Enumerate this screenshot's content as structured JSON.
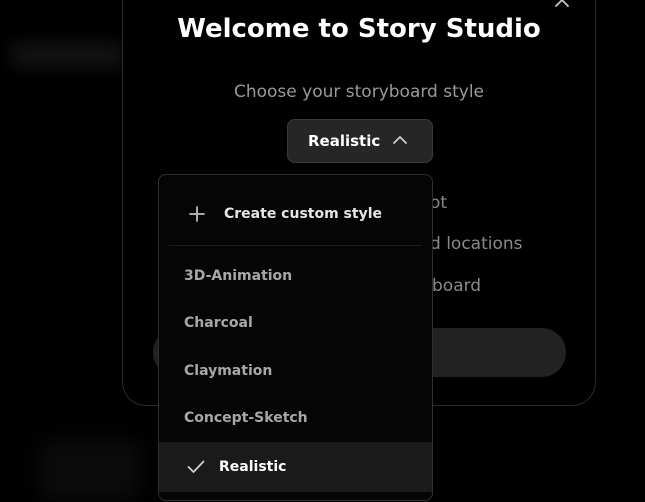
{
  "modal": {
    "title": "Welcome to Story Studio",
    "subtitle": "Choose your storyboard style",
    "behind_lines": [
      "ot",
      "d locations",
      "board"
    ]
  },
  "style_select": {
    "selected": "Realistic"
  },
  "dropdown": {
    "create_label": "Create custom style",
    "items": [
      {
        "label": "3D-Animation",
        "selected": false
      },
      {
        "label": "Charcoal",
        "selected": false
      },
      {
        "label": "Claymation",
        "selected": false
      },
      {
        "label": "Concept-Sketch",
        "selected": false
      },
      {
        "label": "Realistic",
        "selected": true
      }
    ]
  },
  "icons": {
    "close": "close-icon",
    "chevron": "chevron-up-icon",
    "plus": "plus-icon",
    "check": "check-icon"
  },
  "colors": {
    "background": "#000000",
    "select_bg": "#262626",
    "selected_item_bg": "#1a1a1a"
  }
}
